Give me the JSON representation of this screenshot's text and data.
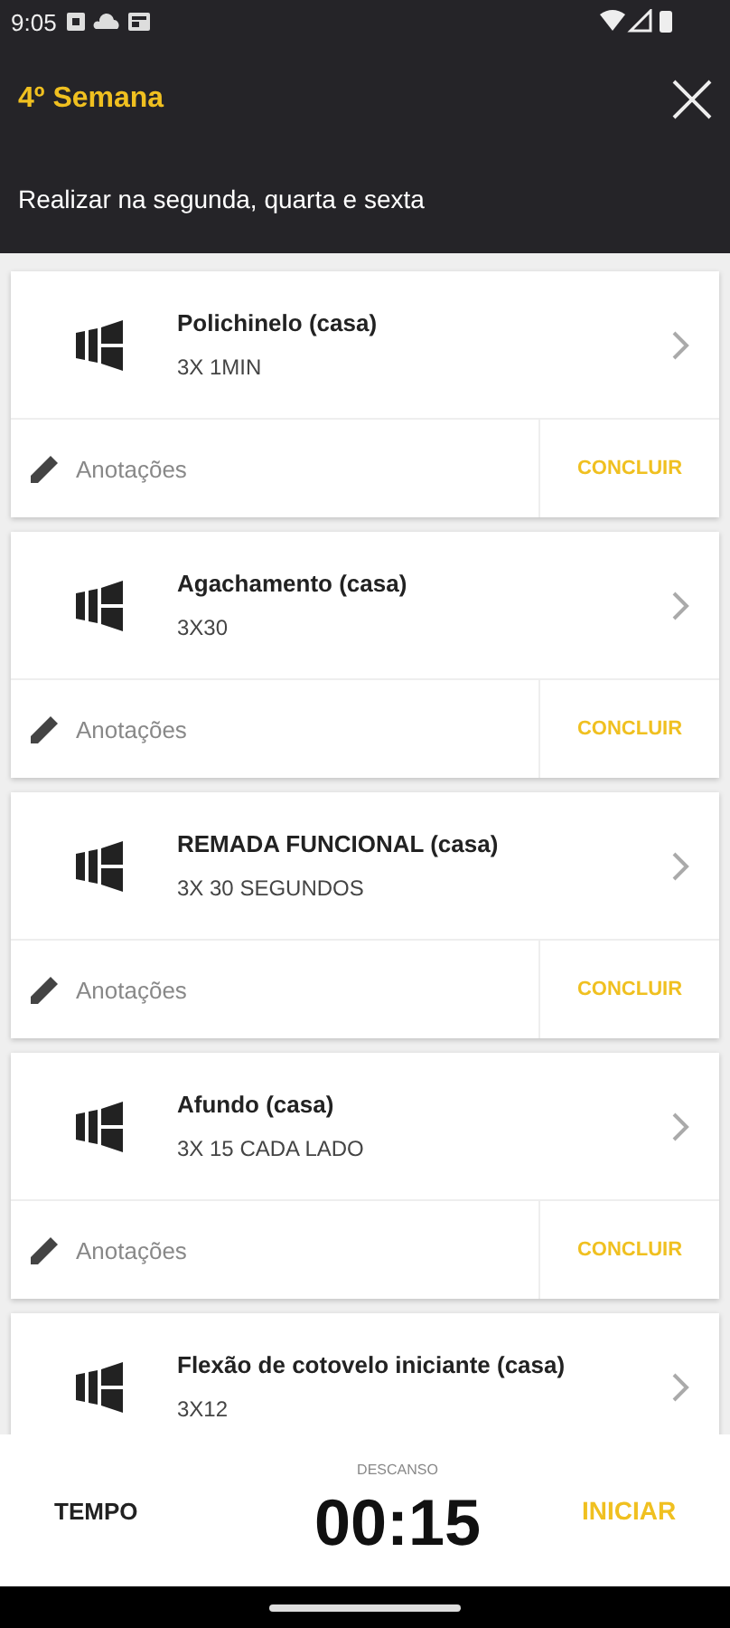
{
  "status_bar": {
    "time": "9:05"
  },
  "header": {
    "title": "4º Semana",
    "subtitle": "Realizar na segunda, quarta e sexta"
  },
  "exercises": [
    {
      "name": "Polichinelo (casa)",
      "detail": "3X 1MIN",
      "notes": "Anotações",
      "action": "CONCLUIR"
    },
    {
      "name": "Agachamento (casa)",
      "detail": "3X30",
      "notes": "Anotações",
      "action": "CONCLUIR"
    },
    {
      "name": "REMADA FUNCIONAL (casa)",
      "detail": "3X 30 SEGUNDOS",
      "notes": "Anotações",
      "action": "CONCLUIR"
    },
    {
      "name": "Afundo (casa)",
      "detail": "3X 15 CADA LADO",
      "notes": "Anotações",
      "action": "CONCLUIR"
    },
    {
      "name": "Flexão de cotovelo iniciante (casa)",
      "detail": "3X12"
    }
  ],
  "timer": {
    "label": "TEMPO",
    "caption": "DESCANSO",
    "value": "00:15",
    "button": "INICIAR"
  }
}
